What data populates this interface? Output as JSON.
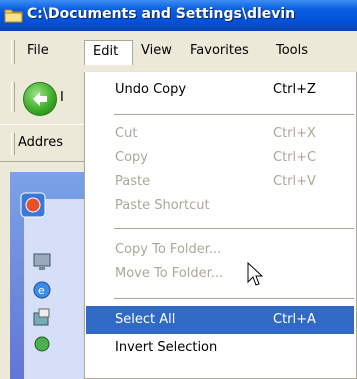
{
  "window": {
    "title": "C:\\Documents and Settings\\dlevin",
    "folder_icon": "folder-icon"
  },
  "menubar": {
    "items": [
      "File",
      "Edit",
      "View",
      "Favorites",
      "Tools"
    ],
    "open_item": "Edit"
  },
  "toolbar": {
    "back_icon": "back-arrow-icon",
    "back_label_fragment": "I"
  },
  "addressbar": {
    "label": "Addres"
  },
  "edit_menu": {
    "items": [
      {
        "label": "Undo Copy",
        "shortcut": "Ctrl+Z",
        "enabled": true
      },
      {
        "label": "Cut",
        "shortcut": "Ctrl+X",
        "enabled": false
      },
      {
        "label": "Copy",
        "shortcut": "Ctrl+C",
        "enabled": false
      },
      {
        "label": "Paste",
        "shortcut": "Ctrl+V",
        "enabled": false
      },
      {
        "label": "Paste Shortcut",
        "shortcut": "",
        "enabled": false
      },
      {
        "label": "Copy To Folder...",
        "shortcut": "",
        "enabled": false
      },
      {
        "label": "Move To Folder...",
        "shortcut": "",
        "enabled": false
      },
      {
        "label": "Select All",
        "shortcut": "Ctrl+A",
        "enabled": true,
        "selected": true
      },
      {
        "label": "Invert Selection",
        "shortcut": "",
        "enabled": true
      }
    ],
    "highlight_color": "#316ac5",
    "disabled_color": "#aca899"
  },
  "left_pane": {
    "icons": [
      "system-tasks-icon",
      "desktop-icon",
      "ie-icon",
      "network-icon",
      "globe-icon"
    ]
  },
  "cursor": "arrow-cursor-icon"
}
